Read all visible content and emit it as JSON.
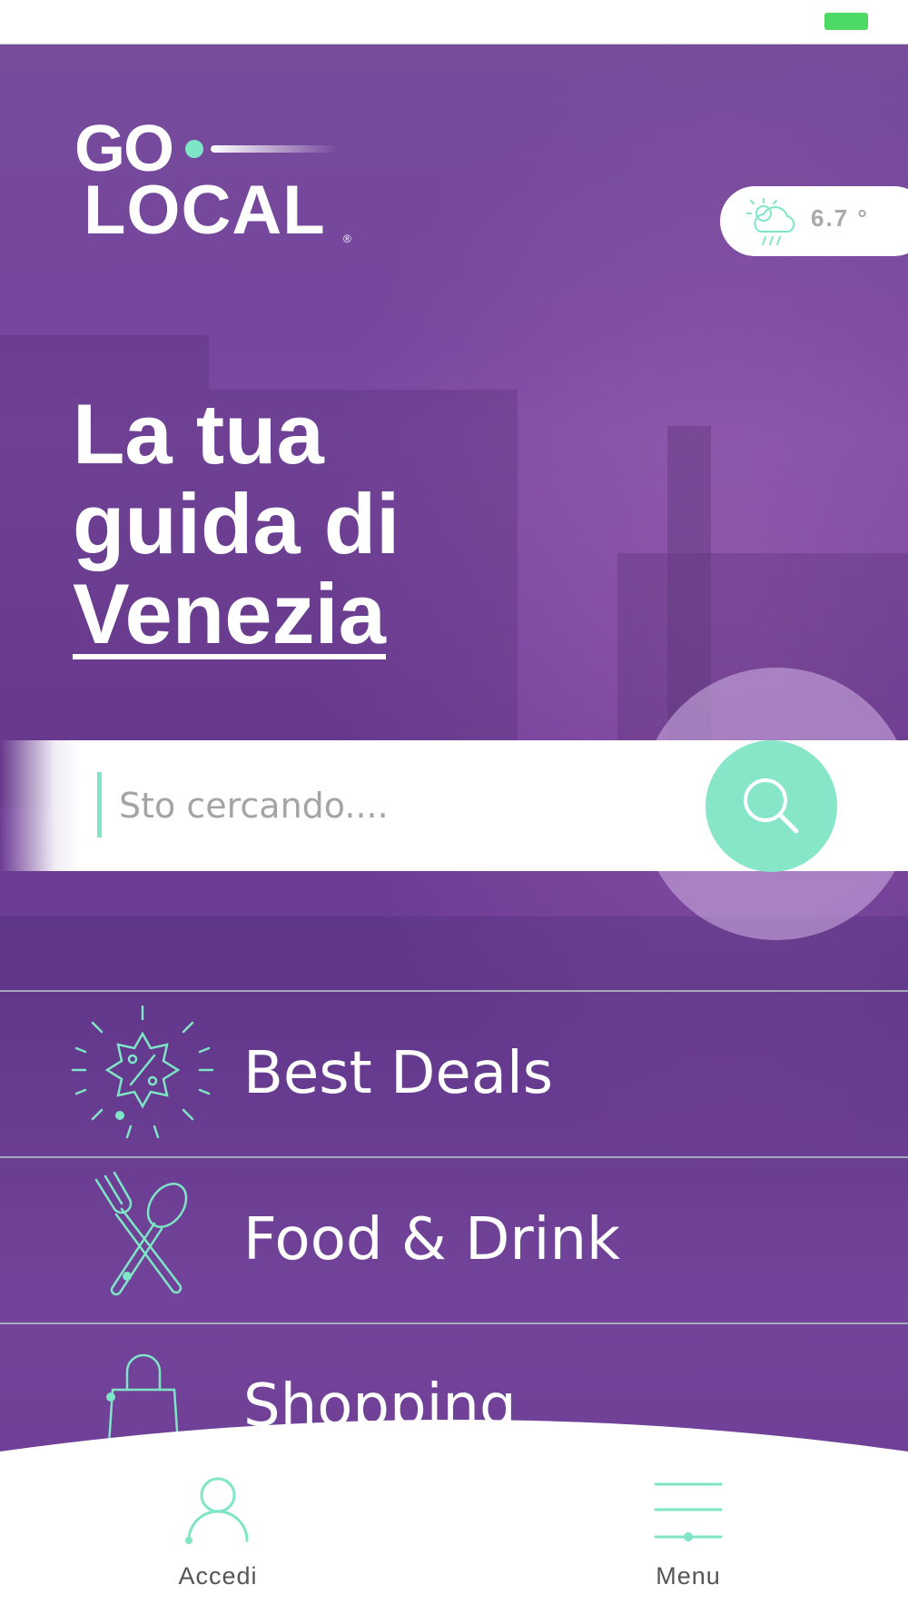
{
  "status_bar": {
    "battery_color": "#4cd964"
  },
  "logo": {
    "line1": "GO",
    "line2": "LOCAL",
    "registered": "®",
    "accent_color": "#7ee6c6"
  },
  "weather": {
    "icon": "cloud-sun-rain-icon",
    "temperature": "6.7 °"
  },
  "headline": {
    "line1": "La tua",
    "line2": "guida di",
    "city": "Venezia"
  },
  "search": {
    "placeholder": "Sto cercando....",
    "value": "",
    "button_icon": "search-icon"
  },
  "categories": [
    {
      "label": "Best Deals",
      "icon": "discount-badge-icon"
    },
    {
      "label": "Food & Drink",
      "icon": "fork-spoon-icon"
    },
    {
      "label": "Shopping",
      "icon": "shopping-bag-icon"
    }
  ],
  "tab_bar": {
    "accedi": {
      "label": "Accedi",
      "icon": "user-icon"
    },
    "menu": {
      "label": "Menu",
      "icon": "menu-lines-icon"
    }
  },
  "colors": {
    "brand_purple": "#6f3d98",
    "accent_mint": "#86e6c7"
  }
}
